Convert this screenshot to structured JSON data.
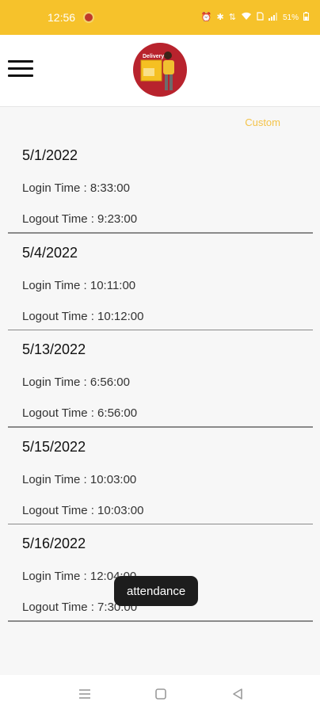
{
  "status_bar": {
    "time": "12:56",
    "indicators": "⏰ ✱ ⁰·⁰⁰",
    "battery": "51%"
  },
  "header": {
    "logo_text": "Delivery"
  },
  "filter": {
    "label": "Custom"
  },
  "records": [
    {
      "date": "5/1/2022",
      "login": "Login Time : 8:33:00",
      "logout": "Logout Time : 9:23:00"
    },
    {
      "date": "5/4/2022",
      "login": "Login Time : 10:11:00",
      "logout": "Logout Time : 10:12:00"
    },
    {
      "date": "5/13/2022",
      "login": "Login Time : 6:56:00",
      "logout": "Logout Time : 6:56:00"
    },
    {
      "date": "5/15/2022",
      "login": "Login Time : 10:03:00",
      "logout": "Logout Time : 10:03:00"
    },
    {
      "date": "5/16/2022",
      "login": "Login Time : 12:04:00",
      "logout": "Logout Time : 7:30:00"
    }
  ],
  "toast": {
    "message": "attendance"
  },
  "colors": {
    "accent": "#f6c22b",
    "link": "#f4c34a",
    "logo_bg": "#b8232d"
  },
  "icons": {
    "menu": "hamburger-icon",
    "nav_menu": "recent-apps-icon",
    "nav_home": "home-icon",
    "nav_back": "back-icon"
  }
}
